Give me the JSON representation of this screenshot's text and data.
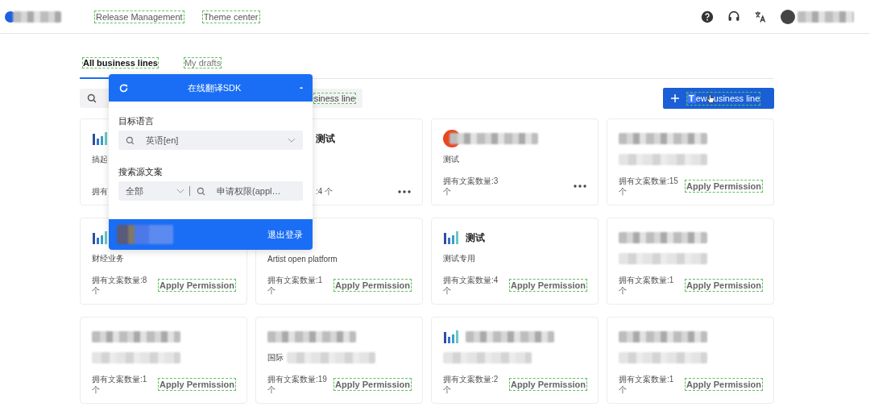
{
  "header": {
    "nav": [
      {
        "label": "Release Management",
        "highlighted": true
      },
      {
        "label": "Theme center",
        "highlighted": true
      }
    ]
  },
  "tabs": [
    {
      "label": "All business lines",
      "selected": true,
      "highlighted": true
    },
    {
      "label": "My drafts",
      "selected": false,
      "highlighted": true
    }
  ],
  "search": {
    "visible_text": "siness line",
    "highlighted": true
  },
  "new_button": {
    "label_parts": [
      {
        "text": "T",
        "selected": true
      },
      {
        "text": "ew",
        "selected": false
      },
      {
        "text": "usiness line",
        "selected": false
      }
    ]
  },
  "cards": [
    {
      "kind": "full",
      "logo": {
        "kind": "bars"
      },
      "description": "搞起",
      "count": "拥有",
      "action": {
        "kind": "none"
      }
    },
    {
      "kind": "covered-left",
      "title": "测试",
      "count": ":4 个",
      "action": {
        "kind": "more"
      }
    },
    {
      "kind": "full",
      "logo": {
        "kind": "circle"
      },
      "title_blurred": true,
      "description": "测试",
      "count": "拥有文案数量:3 个",
      "action": {
        "kind": "more"
      }
    },
    {
      "kind": "full",
      "title_blurred": true,
      "description_blurred": true,
      "count": "拥有文案数量:15 个",
      "action": {
        "kind": "apply",
        "label": "Apply Permission",
        "highlighted": true
      }
    },
    {
      "kind": "full",
      "logo": {
        "kind": "bars"
      },
      "description": "财经业务",
      "count": "拥有文案数量:8 个",
      "action": {
        "kind": "apply",
        "label": "Apply Permission",
        "highlighted": true
      }
    },
    {
      "kind": "full",
      "description": "Artist open platform",
      "count": "拥有文案数量:1 个",
      "action": {
        "kind": "apply",
        "label": "Apply Permission",
        "highlighted": true
      }
    },
    {
      "kind": "full",
      "logo": {
        "kind": "bars"
      },
      "title": "测试",
      "description": "测试专用",
      "count": "拥有文案数量:4 个",
      "action": {
        "kind": "apply",
        "label": "Apply Permission",
        "highlighted": true
      }
    },
    {
      "kind": "full",
      "title_blurred": true,
      "description_blurred": true,
      "count": "拥有文案数量:1 个",
      "action": {
        "kind": "apply",
        "label": "Apply Permission",
        "highlighted": true
      }
    },
    {
      "kind": "full",
      "title_blurred": true,
      "description_blurred": true,
      "count": "拥有文案数量:1 个",
      "action": {
        "kind": "apply",
        "label": "Apply Permission",
        "highlighted": true
      }
    },
    {
      "kind": "full",
      "title_blurred": true,
      "description": "国际",
      "description_blurred": true,
      "count": "拥有文案数量:19 个",
      "action": {
        "kind": "apply",
        "label": "Apply Permission",
        "highlighted": true
      }
    },
    {
      "kind": "full",
      "logo": {
        "kind": "bars"
      },
      "title_blurred": true,
      "description_blurred": true,
      "count": "拥有文案数量:2 个",
      "action": {
        "kind": "apply",
        "label": "Apply Permission",
        "highlighted": true
      }
    },
    {
      "kind": "full",
      "title_blurred": true,
      "description_blurred": true,
      "count": "拥有文案数量:1 个",
      "action": {
        "kind": "apply",
        "label": "Apply Permission",
        "highlighted": true
      }
    }
  ],
  "sdk_panel": {
    "title": "在线翻译SDK",
    "minimize": "-",
    "target_label": "目标语言",
    "target_value": "英语[en]",
    "source_label": "搜索源文案",
    "filter_value": "全部",
    "search_value": "申请权限(appl…",
    "logout": "退出登录"
  }
}
